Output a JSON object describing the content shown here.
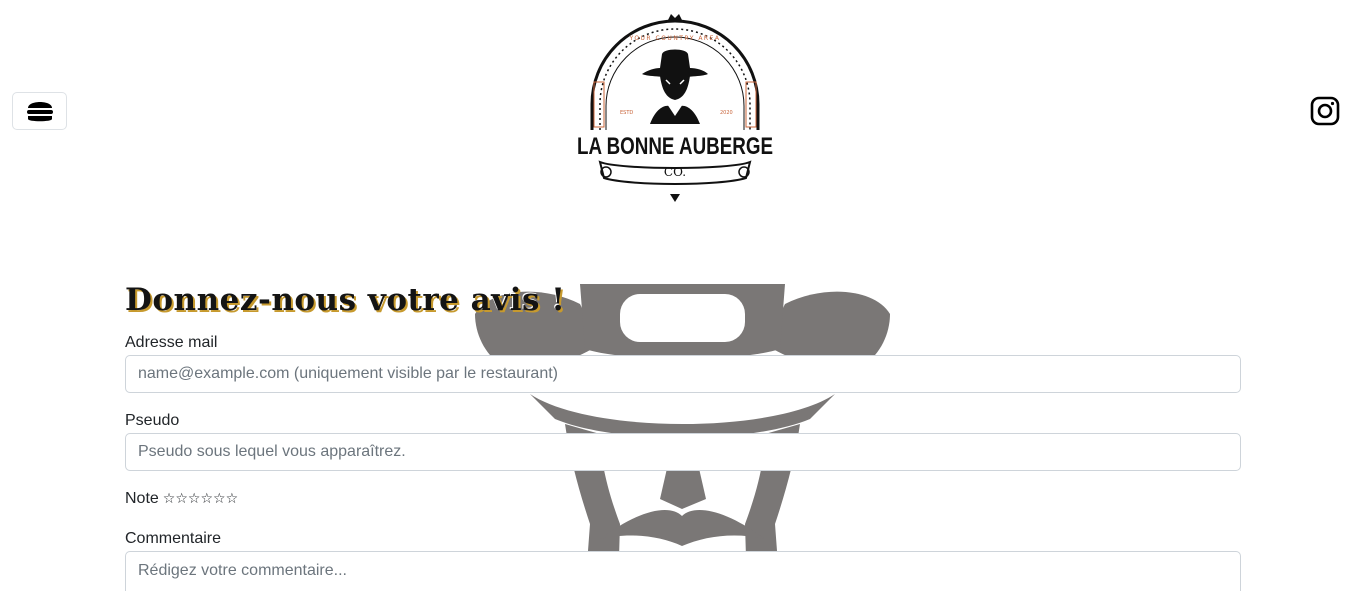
{
  "header": {
    "menu_icon": "burger-icon",
    "social_icon": "instagram-icon",
    "logo": {
      "top_arc_text": "YOUR COUNTRY AREA",
      "estd_label": "ESTD",
      "year": "2020",
      "name": "LA BONNE AUBERGE",
      "suffix": "CO."
    }
  },
  "form": {
    "title": "Donnez-nous votre avis !",
    "email": {
      "label": "Adresse mail",
      "placeholder": "name@example.com (uniquement visible par le restaurant)"
    },
    "pseudo": {
      "label": "Pseudo",
      "placeholder": "Pseudo sous lequel vous apparaîtrez."
    },
    "rating": {
      "label": "Note",
      "stars": [
        "☆",
        "☆",
        "☆",
        "☆",
        "☆",
        "☆"
      ],
      "value": 0
    },
    "comment": {
      "label": "Commentaire",
      "placeholder": "Rédigez votre commentaire..."
    }
  },
  "colors": {
    "accent": "#c79a2e",
    "logo_orange": "#c8643a",
    "watermark": "#7a7776",
    "border": "#ced4da"
  }
}
